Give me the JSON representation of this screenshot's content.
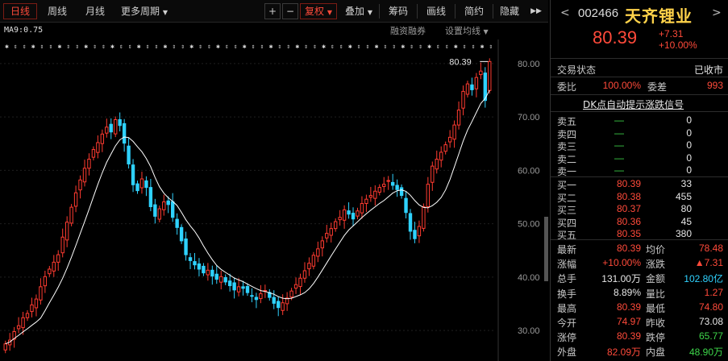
{
  "toolbar": {
    "daily": "日线",
    "weekly": "周线",
    "monthly": "月线",
    "more_periods": "更多周期",
    "zoom_in": "+",
    "zoom_out": "−",
    "adjust": "复权",
    "overlay": "叠加",
    "chips": "筹码",
    "draw_line": "画线",
    "simple": "简约",
    "hide": "隐藏",
    "expand": "▶▶"
  },
  "chart_header": {
    "ma_label": "MA9:0.75",
    "margin_link": "融资融券",
    "ma_setting": "设置均线"
  },
  "chart_data": {
    "type": "candlestick",
    "yaxis_ticks": [
      30.0,
      40.0,
      50.0,
      60.0,
      70.0,
      80.0
    ],
    "ylim": [
      25.8,
      81.5
    ],
    "last_price_label": "80.39",
    "moving_average": "MA9",
    "closes": [
      27.5,
      28.2,
      29.8,
      30.9,
      32.4,
      33.2,
      34.8,
      35.9,
      38.2,
      40.1,
      41.5,
      42.8,
      44.2,
      47.5,
      50.3,
      53.1,
      55.8,
      58.2,
      60.4,
      62.1,
      63.9,
      65.2,
      66.8,
      68.1,
      67.2,
      69.5,
      68.4,
      65.1,
      61.2,
      57.3,
      56.2,
      58.4,
      56.8,
      53.2,
      51.4,
      52.8,
      54.1,
      53.6,
      51.2,
      49.3,
      46.8,
      44.2,
      43.1,
      42.3,
      41.5,
      40.8,
      41.3,
      40.2,
      39.6,
      40.1,
      39.1,
      38.4,
      37.6,
      38.2,
      37.9,
      37.1,
      36.4,
      35.8,
      36.9,
      37.5,
      36.2,
      35.1,
      34.3,
      35.2,
      36.1,
      37.4,
      38.6,
      39.8,
      41.2,
      42.6,
      44.1,
      45.3,
      46.8,
      48.2,
      49.1,
      50.4,
      51.2,
      52.6,
      51.8,
      50.9,
      52.4,
      53.8,
      54.6,
      55.3,
      56.1,
      56.8,
      57.4,
      58.1,
      57.2,
      56.4,
      55.3,
      52.1,
      48.6,
      47.2,
      49.5,
      53.2,
      57.4,
      60.8,
      62.1,
      63.4,
      64.8,
      66.2,
      68.5,
      71.3,
      74.8,
      76.2,
      75.1,
      77.4,
      78.6,
      73.1,
      80.39
    ]
  },
  "quote": {
    "prev": "<",
    "next": ">",
    "code": "002466",
    "name": "天齐锂业",
    "price": "80.39",
    "change": "+7.31",
    "change_pct": "+10.00%",
    "status_label": "交易状态",
    "status_value": "已收市",
    "commission_ratio_label": "委比",
    "commission_ratio_value": "100.00%",
    "commission_diff_label": "委差",
    "commission_diff_value": "993",
    "dk_signal": "DK点自动提示涨跌信号",
    "asks": [
      {
        "label": "卖五",
        "price": "—",
        "vol": "0"
      },
      {
        "label": "卖四",
        "price": "—",
        "vol": "0"
      },
      {
        "label": "卖三",
        "price": "—",
        "vol": "0"
      },
      {
        "label": "卖二",
        "price": "—",
        "vol": "0"
      },
      {
        "label": "卖一",
        "price": "—",
        "vol": "0"
      }
    ],
    "bids": [
      {
        "label": "买一",
        "price": "80.39",
        "vol": "33"
      },
      {
        "label": "买二",
        "price": "80.38",
        "vol": "455"
      },
      {
        "label": "买三",
        "price": "80.37",
        "vol": "80"
      },
      {
        "label": "买四",
        "price": "80.36",
        "vol": "45"
      },
      {
        "label": "买五",
        "price": "80.35",
        "vol": "380"
      }
    ],
    "stats": [
      {
        "l1": "最新",
        "v1": "80.39",
        "c1": "red",
        "l2": "均价",
        "v2": "78.48",
        "c2": "red"
      },
      {
        "l1": "涨幅",
        "v1": "+10.00%",
        "c1": "red",
        "l2": "涨跌",
        "v2": "▲7.31",
        "c2": "red"
      },
      {
        "l1": "总手",
        "v1": "131.00万",
        "c1": "white",
        "l2": "金额",
        "v2": "102.80亿",
        "c2": "cyan"
      },
      {
        "l1": "换手",
        "v1": "8.89%",
        "c1": "white",
        "l2": "量比",
        "v2": "1.27",
        "c2": "red"
      },
      {
        "l1": "最高",
        "v1": "80.39",
        "c1": "red",
        "l2": "最低",
        "v2": "74.80",
        "c2": "red"
      },
      {
        "l1": "今开",
        "v1": "74.97",
        "c1": "red",
        "l2": "昨收",
        "v2": "73.08",
        "c2": "white"
      },
      {
        "l1": "涨停",
        "v1": "80.39",
        "c1": "red",
        "l2": "跌停",
        "v2": "65.77",
        "c2": "green"
      },
      {
        "l1": "外盘",
        "v1": "82.09万",
        "c1": "red",
        "l2": "内盘",
        "v2": "48.90万",
        "c2": "green"
      }
    ]
  },
  "colors": {
    "up": "#ff3b30",
    "down": "#2fd2ff",
    "ma": "#ffffff",
    "name": "#ffd24a"
  }
}
